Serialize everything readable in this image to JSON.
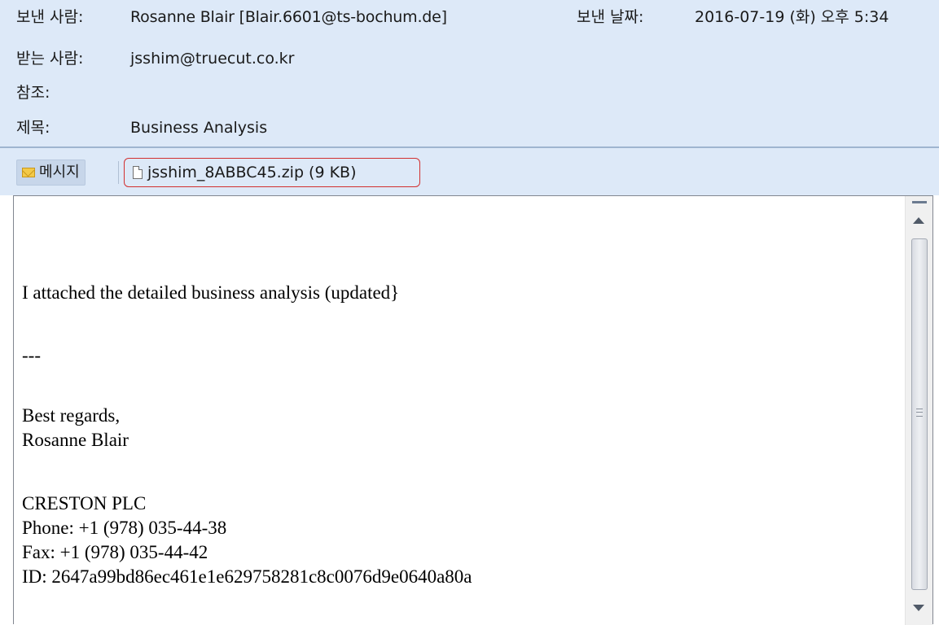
{
  "header": {
    "from_label": "보낸 사람:",
    "from_value": "Rosanne Blair [Blair.6601@ts-bochum.de]",
    "date_label": "보낸 날짜:",
    "date_value": "2016-07-19 (화) 오후 5:34",
    "to_label": "받는 사람:",
    "to_value": "jsshim@truecut.co.kr",
    "cc_label": "참조:",
    "cc_value": "",
    "subject_label": "제목:",
    "subject_value": "Business Analysis"
  },
  "tabs": {
    "message_label": "메시지",
    "attachment_label": "jsshim_8ABBC45.zip (9 KB)"
  },
  "body": {
    "line1": "I attached the detailed business analysis (updated}",
    "line2": "---",
    "line3": "Best regards,",
    "line4": "Rosanne Blair",
    "line5": "CRESTON PLC",
    "line6": "Phone: +1 (978) 035-44-38",
    "line7": "Fax: +1 (978) 035-44-42",
    "line8": "ID: 2647a99bd86ec461e1e629758281c8c0076d9e0640a80a"
  },
  "icons": {
    "message_tab_icon": "envelope-icon",
    "attachment_icon": "file-icon"
  },
  "colors": {
    "header_background": "#dde9f8",
    "attachment_highlight": "#d23030"
  }
}
